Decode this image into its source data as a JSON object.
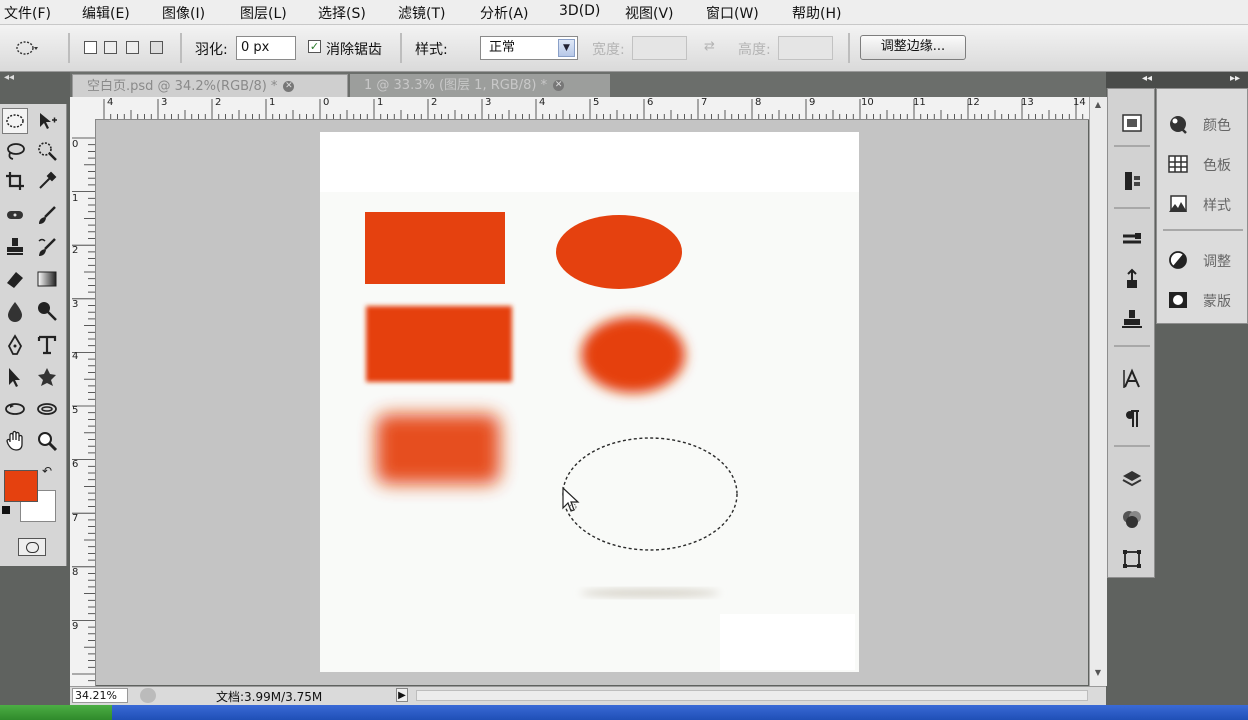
{
  "menubar": {
    "items": [
      "文件(F)",
      "编辑(E)",
      "图像(I)",
      "图层(L)",
      "选择(S)",
      "滤镜(T)",
      "分析(A)",
      "3D(D)",
      "视图(V)",
      "窗口(W)",
      "帮助(H)"
    ]
  },
  "options": {
    "feather_label": "羽化:",
    "feather_value": "0 px",
    "antialias_label": "消除锯齿",
    "antialias_checked": true,
    "style_label": "样式:",
    "style_value": "正常",
    "width_label": "宽度:",
    "height_label": "高度:",
    "refine_edge_button": "调整边缘..."
  },
  "tabs": [
    {
      "label": "空白页.psd @ 34.2%(RGB/8) *",
      "active": true
    },
    {
      "label": "1 @ 33.3% (图层 1, RGB/8) *",
      "active": false
    }
  ],
  "rulers": {
    "horizontal": [
      "4",
      "3",
      "2",
      "1",
      "0",
      "1",
      "2",
      "3",
      "4",
      "5",
      "6",
      "7",
      "8",
      "9",
      "10",
      "11",
      "12",
      "13",
      "14"
    ],
    "vertical": [
      "0",
      "1",
      "2",
      "3",
      "4",
      "5",
      "6",
      "7",
      "8",
      "9"
    ]
  },
  "status": {
    "zoom": "34.21%",
    "doc_label": "文档:3.99M/3.75M"
  },
  "colors": {
    "foreground": "#e5410f",
    "background": "#ffffff",
    "shape_orange": "#e5410f",
    "workspace_gray": "#c4c4c4"
  },
  "panels": [
    {
      "label": "颜色",
      "icon": "color-wheel-icon"
    },
    {
      "label": "色板",
      "icon": "swatches-icon"
    },
    {
      "label": "样式",
      "icon": "styles-icon"
    },
    {
      "label": "调整",
      "icon": "adjustments-icon"
    },
    {
      "label": "蒙版",
      "icon": "masks-icon"
    }
  ]
}
